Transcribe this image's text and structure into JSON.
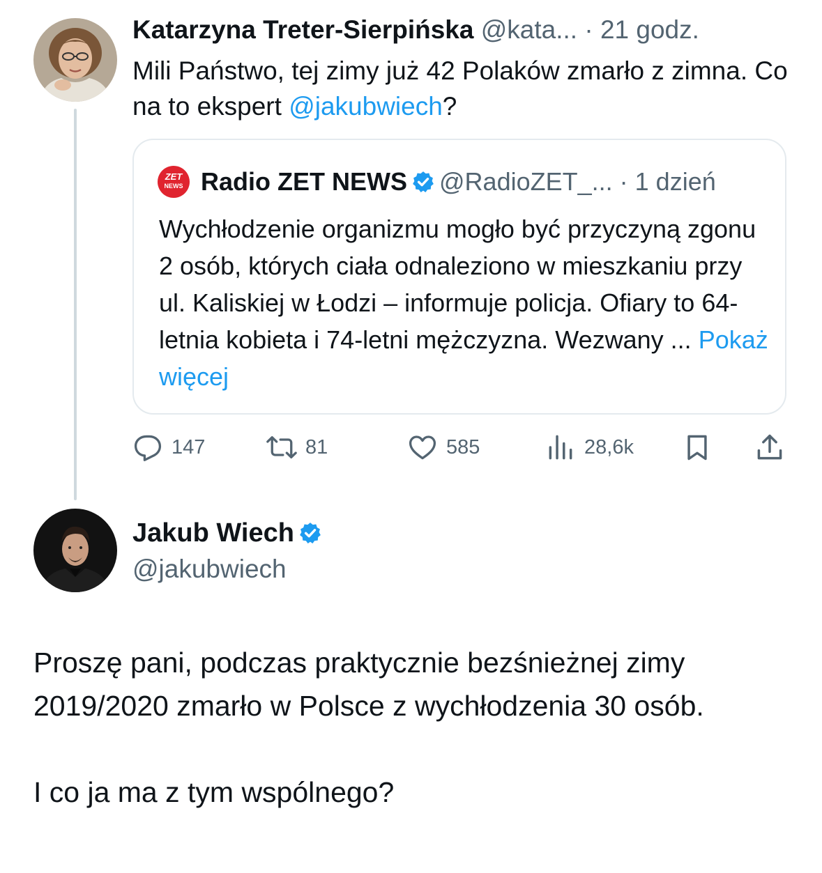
{
  "colors": {
    "text": "#0f1419",
    "muted": "#536471",
    "link": "#1d9bf0",
    "border": "#e4eaee",
    "verified": "#1d9bf0",
    "radio_zet_red": "#e0242f"
  },
  "original_tweet": {
    "author_name": "Katarzyna Treter-Sierpińska",
    "handle": "@kata...",
    "separator": "·",
    "time": "21 godz.",
    "text_before": "Mili Państwo, tej zimy już 42 Polaków zmarło z zimna. Co na to ekspert ",
    "mention": "@jakubwiech",
    "text_after": "?",
    "avatar_icon": "profile-photo-woman"
  },
  "quoted_tweet": {
    "logo_line1": "ZET",
    "logo_line2": "NEWS",
    "author_name": "Radio ZET NEWS",
    "verified_icon": "verified-badge-icon",
    "handle": "@RadioZET_...",
    "separator": "·",
    "time": "1 dzień",
    "text": "Wychłodzenie organizmu mogło być przyczyną zgonu 2 osób, których ciała odnaleziono w mieszkaniu przy ul. Kaliskiej w Łodzi – informuje policja. Ofiary to 64-letnia kobieta i 74-letni mężczyzna. Wezwany ... ",
    "show_more": "Pokaż więcej"
  },
  "actions": {
    "reply_count": "147",
    "retweet_count": "81",
    "like_count": "585",
    "views_count": "28,6k",
    "icons": [
      "reply-icon",
      "retweet-icon",
      "like-icon",
      "views-icon",
      "bookmark-icon",
      "share-icon"
    ]
  },
  "reply_tweet": {
    "author_name": "Jakub Wiech",
    "handle": "@jakubwiech",
    "verified_icon": "verified-badge-icon",
    "avatar_icon": "profile-photo-man",
    "paragraph1": "Proszę pani, podczas praktycznie bezśnieżnej zimy 2019/2020 zmarło w Polsce z wychłodzenia 30 osób.",
    "paragraph2": "I co ja ma z tym wspólnego?"
  }
}
